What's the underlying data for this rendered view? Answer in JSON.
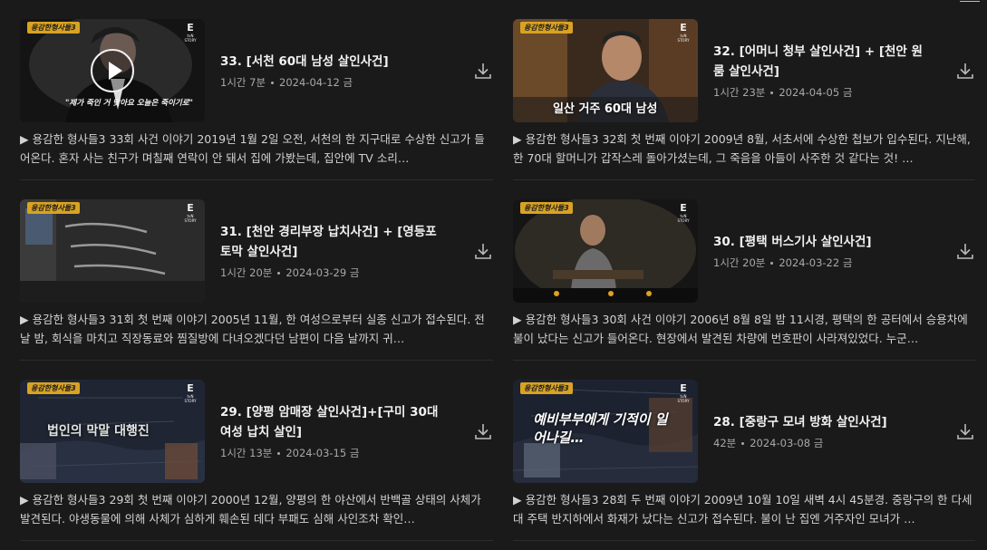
{
  "episodes": [
    {
      "title": "33. [서천 60대 남성 살인사건]",
      "duration": "1시간 7분",
      "date": "2024-04-12 금",
      "description": "▶ 용감한 형사들3 33회 사건 이야기 2019년 1월 2일 오전, 서천의 한 지구대로 수상한 신고가 들어온다. 혼자 사는 친구가 며칠째 연락이 안 돼서 집에 가봤는데, 집안에 TV 소리…",
      "badge": "용감한형사들3",
      "thumb_text": "\"제가 죽인 거 맞아요 오늘은 죽이기로\"",
      "playing": true
    },
    {
      "title": "32. [어머니 청부 살인사건] + [천안 원룸 살인사건]",
      "duration": "1시간 23분",
      "date": "2024-04-05 금",
      "description": "▶ 용감한 형사들3 32회 첫 번째 이야기 2009년 8월, 서초서에 수상한 첩보가 입수된다. 지난해, 한 70대 할머니가 갑작스레 돌아가셨는데, 그 죽음을 아들이 사주한 것 같다는 것! …",
      "badge": "용감한형사들3",
      "thumb_text": "일산 거주 60대 남성",
      "playing": false
    },
    {
      "title": "31. [천안 경리부장 납치사건] + [영등포 토막 살인사건]",
      "duration": "1시간 20분",
      "date": "2024-03-29 금",
      "description": "▶ 용감한 형사들3 31회 첫 번째 이야기 2005년 11월, 한 여성으로부터 실종 신고가 접수된다. 전날 밤, 회식을 마치고 직장동료와 찜질방에 다녀오겠다던 남편이 다음 날까지 귀…",
      "badge": "용감한형사들3",
      "thumb_text": "",
      "playing": false
    },
    {
      "title": "30. [평택 버스기사 살인사건]",
      "duration": "1시간 20분",
      "date": "2024-03-22 금",
      "description": "▶ 용감한 형사들3 30회 사건 이야기 2006년 8월 8일 밤 11시경, 평택의 한 공터에서 승용차에 불이 났다는 신고가 들어온다. 현장에서 발견된 차량에 번호판이 사라져있었다. 누군…",
      "badge": "용감한형사들3",
      "thumb_text": "",
      "playing": false
    },
    {
      "title": "29. [양평 암매장 살인사건]+[구미 30대 여성 납치 살인]",
      "duration": "1시간 13분",
      "date": "2024-03-15 금",
      "description": "▶ 용감한 형사들3 29회 첫 번째 이야기 2000년 12월, 양평의 한 야산에서 반백골 상태의 사체가 발견된다. 야생동물에 의해 사체가 심하게 훼손된 데다 부패도 심해 사인조차 확인…",
      "badge": "용감한형사들3",
      "thumb_text": "법인의 막말 대행진",
      "playing": false
    },
    {
      "title": "28. [중랑구 모녀 방화 살인사건]",
      "duration": "42분",
      "date": "2024-03-08 금",
      "description": "▶ 용감한 형사들3 28회 두 번째 이야기 2009년 10월 10일 새벽 4시 45분경. 중랑구의 한 다세대 주택 반지하에서 화재가 났다는 신고가 접수된다. 불이 난 집엔 거주자인 모녀가 …",
      "badge": "용감한형사들3",
      "thumb_text": "예비부부에게 기적이 일어나길…",
      "playing": false
    }
  ],
  "channel_logo": "E",
  "channel_logo_sub": "tvN STORY",
  "icons": {
    "download": "download-icon",
    "play": "play-icon",
    "menu": "menu-icon"
  },
  "colors": {
    "background": "#1a1a1a",
    "badge": "#d8a323",
    "meta": "#a8a8a8"
  }
}
